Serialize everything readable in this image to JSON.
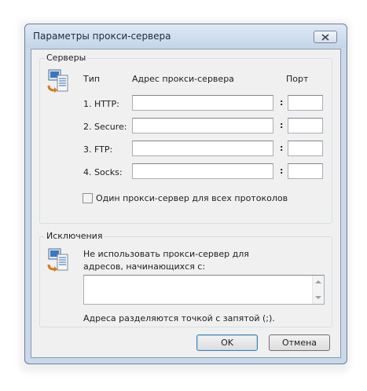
{
  "window": {
    "title": "Параметры прокси-сервера"
  },
  "servers": {
    "group_label": "Серверы",
    "col_type": "Тип",
    "col_address": "Адрес прокси-сервера",
    "col_port": "Порт",
    "rows": [
      {
        "type": "1. HTTP:",
        "address": "",
        "port": ""
      },
      {
        "type": "2. Secure:",
        "address": "",
        "port": ""
      },
      {
        "type": "3. FTP:",
        "address": "",
        "port": ""
      },
      {
        "type": "4. Socks:",
        "address": "",
        "port": ""
      }
    ],
    "colon": ":",
    "same_proxy_label": "Один прокси-сервер для всех протоколов",
    "same_proxy_checked": false
  },
  "exceptions": {
    "group_label": "Исключения",
    "description": "Не использовать прокси-сервер для адресов, начинающихся с:",
    "value": "",
    "hint": "Адреса разделяются точкой с запятой (;)."
  },
  "buttons": {
    "ok": "OK",
    "cancel": "Отмена"
  }
}
